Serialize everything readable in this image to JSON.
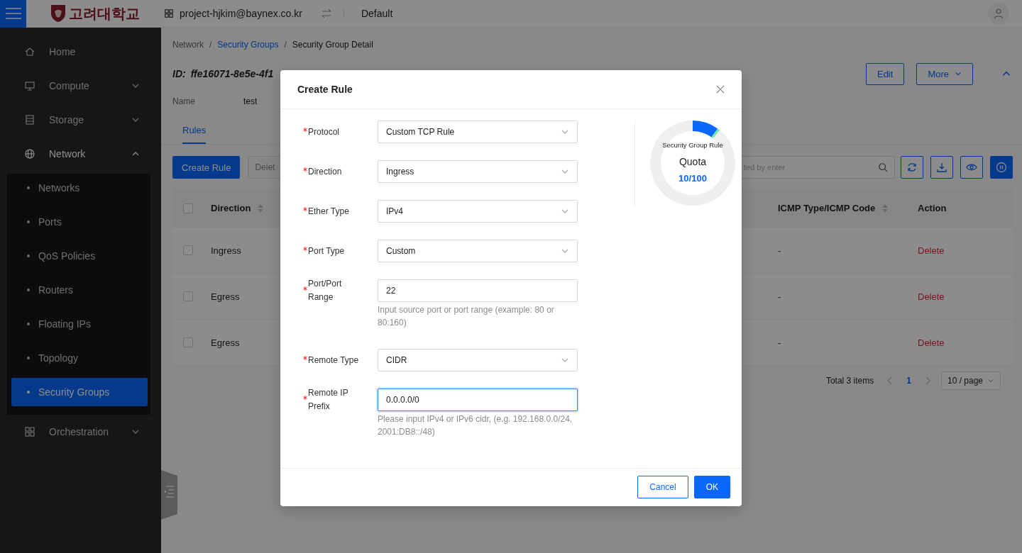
{
  "header": {
    "logo_text": "고려대학교",
    "project": "project-hjkim@baynex.co.kr",
    "region": "Default"
  },
  "sidebar": {
    "items": [
      {
        "label": "Home"
      },
      {
        "label": "Compute",
        "expanded": false
      },
      {
        "label": "Storage",
        "expanded": false
      },
      {
        "label": "Network",
        "expanded": true,
        "children": [
          {
            "label": "Networks",
            "selected": false
          },
          {
            "label": "Ports",
            "selected": false
          },
          {
            "label": "QoS Policies",
            "selected": false
          },
          {
            "label": "Routers",
            "selected": false
          },
          {
            "label": "Floating IPs",
            "selected": false
          },
          {
            "label": "Topology",
            "selected": false
          },
          {
            "label": "Security Groups",
            "selected": true
          }
        ]
      },
      {
        "label": "Orchestration",
        "expanded": false
      }
    ]
  },
  "breadcrumb": [
    {
      "label": "Network",
      "kind": "parent"
    },
    {
      "label": "/",
      "kind": "separator"
    },
    {
      "label": "Security Groups",
      "kind": "link"
    },
    {
      "label": "/",
      "kind": "separator"
    },
    {
      "label": "Security Group Detail",
      "kind": "current"
    }
  ],
  "detail": {
    "id_label": "ID:",
    "id_value": "ffe16071-8e5e-4f1",
    "buttons": [
      "Edit",
      "More"
    ],
    "name_label": "Name",
    "name_value": "test"
  },
  "tabs": [
    {
      "label": "Rules",
      "selected": true
    }
  ],
  "toolbar": {
    "create": "Create Rule",
    "delete": {
      "label": "Delet",
      "disabled": true
    },
    "search_placeholder": "ted by enter"
  },
  "table": {
    "select_all_checked": false,
    "columns": [
      {
        "label": "Direction",
        "sortable": true
      },
      {
        "label": "ICMP Type/ICMP Code",
        "sortable": true
      },
      {
        "label": "Action",
        "sortable": false
      }
    ],
    "rows": [
      {
        "direction": "Ingress",
        "icmp": "-",
        "action": "Delete",
        "checked": false
      },
      {
        "direction": "Egress",
        "icmp": "-",
        "action": "Delete",
        "checked": false
      },
      {
        "direction": "Egress",
        "icmp": "-",
        "action": "Delete",
        "checked": false
      }
    ]
  },
  "pagination": {
    "total": "Total 3 items",
    "pages": [
      {
        "label": "1",
        "selected": true
      }
    ],
    "page_size": "10 / page"
  },
  "modal": {
    "title": "Create Rule",
    "fields": [
      {
        "label": "Protocol",
        "kind": "select",
        "value": "Custom TCP Rule",
        "required": true
      },
      {
        "label": "Direction",
        "kind": "select",
        "value": "Ingress",
        "required": true
      },
      {
        "label": "Ether Type",
        "kind": "select",
        "value": "IPv4",
        "required": true
      },
      {
        "label": "Port Type",
        "kind": "select",
        "value": "Custom",
        "required": true
      },
      {
        "label": "Port/Port Range",
        "kind": "input",
        "value": "22",
        "required": true,
        "focused": false,
        "help": "Input source port or port range (example: 80 or 80:160)"
      },
      {
        "label": "Remote Type",
        "kind": "select",
        "value": "CIDR",
        "required": true
      },
      {
        "label": "Remote IP Prefix",
        "kind": "input",
        "value": "0.0.0.0/0",
        "required": true,
        "focused": true,
        "help": "Please input IPv4 or IPv6 cidr, (e.g. 192.168.0.0/24, 2001:DB8::/48)"
      }
    ],
    "quota": {
      "title": "Security Group Rule",
      "label": "Quota",
      "value": "10/100",
      "chart_data": {
        "type": "donut",
        "values": [
          10,
          1,
          89
        ]
      }
    },
    "buttons": [
      {
        "label": "Cancel",
        "kind": "default"
      },
      {
        "label": "OK",
        "kind": "primary"
      }
    ]
  }
}
